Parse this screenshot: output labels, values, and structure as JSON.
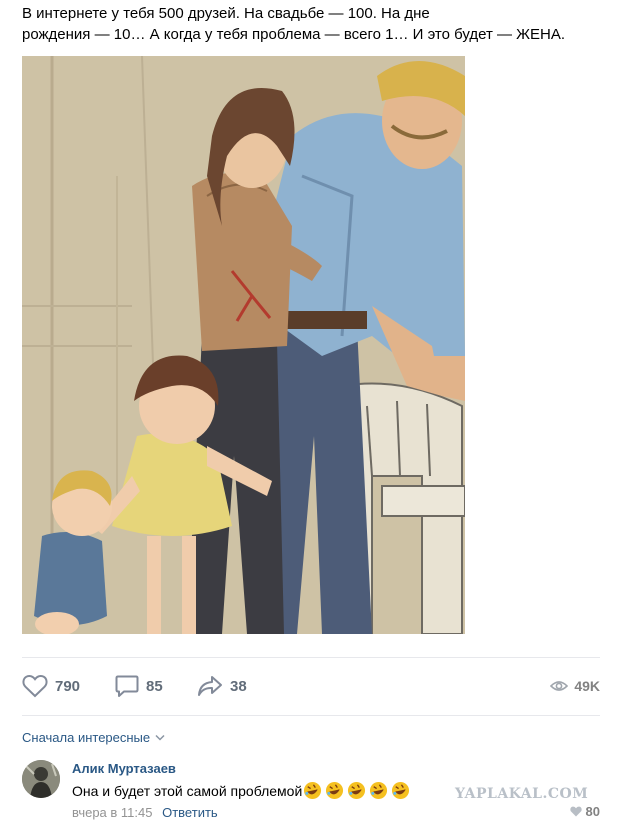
{
  "post": {
    "text_line1": "В интернете у тебя 500 друзей. На свадьбе — 100. На дне",
    "text_line2": "рождения — 10… А когда у тебя проблема — всего 1… И это будет — ЖЕНА."
  },
  "actions": {
    "likes": "790",
    "comments": "85",
    "shares": "38",
    "views": "49K",
    "icons": [
      "heart-icon",
      "comment-icon",
      "share-icon",
      "eye-icon"
    ]
  },
  "comments_section": {
    "sort_label": "Сначала интересные",
    "comment": {
      "author": "Алик Муртазаев",
      "text": "Она и будет этой самой проблемой",
      "emoji_count": 5,
      "time": "вчера в 11:45",
      "reply_label": "Ответить",
      "likes": "80"
    }
  },
  "watermark": "YAPLAKAL.COM",
  "colors": {
    "link": "#2a5885",
    "muted": "#626d7a",
    "divider": "#e7e8ec"
  }
}
